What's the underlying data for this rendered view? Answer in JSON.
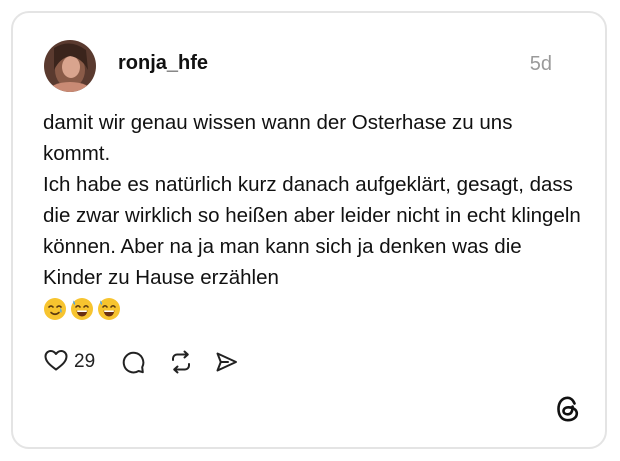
{
  "post": {
    "username": "ronja_hfe",
    "time": "5d",
    "lines": [
      "damit wir genau wissen wann der Osterhase zu uns kommt.",
      "Ich habe es natürlich kurz danach aufgeklärt, gesagt, dass die zwar wirklich so heißen aber leider nicht in echt klingeln können. Aber na ja man kann sich ja denken was die Kinder zu Hause erzählen"
    ],
    "emojis": [
      "smiling-face-with-tear",
      "grinning-face-with-sweat",
      "grinning-face-with-sweat"
    ]
  },
  "actions": {
    "like_count": "29",
    "icons": [
      "heart-icon",
      "comment-icon",
      "repost-icon",
      "share-icon"
    ]
  },
  "brand": {
    "logo": "threads-logo-icon"
  },
  "colors": {
    "text": "#111111",
    "muted": "#9a9a9a",
    "border": "#e4e4e4",
    "emoji": "#f7c42f"
  }
}
